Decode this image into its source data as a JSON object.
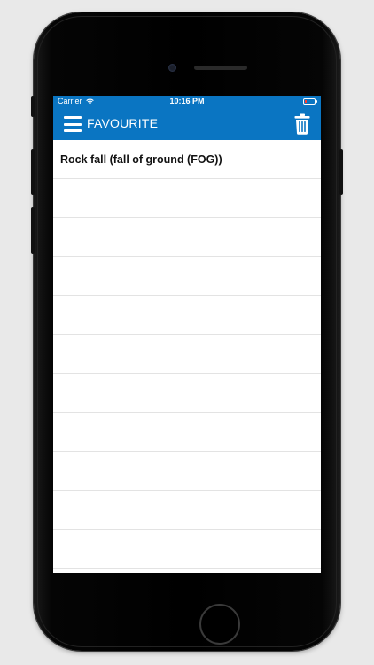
{
  "status_bar": {
    "carrier": "Carrier",
    "time": "10:16 PM",
    "battery_color": "#ff3b30"
  },
  "nav": {
    "title": "FAVOURITE",
    "menu_icon": "hamburger-menu-icon",
    "trash_icon": "trash-icon",
    "bg_color": "#0a75c2"
  },
  "favourites": [
    {
      "title": "Rock fall (fall of ground (FOG))"
    },
    {
      "title": ""
    },
    {
      "title": ""
    },
    {
      "title": ""
    },
    {
      "title": ""
    },
    {
      "title": ""
    },
    {
      "title": ""
    },
    {
      "title": ""
    },
    {
      "title": ""
    },
    {
      "title": ""
    },
    {
      "title": ""
    },
    {
      "title": ""
    }
  ]
}
